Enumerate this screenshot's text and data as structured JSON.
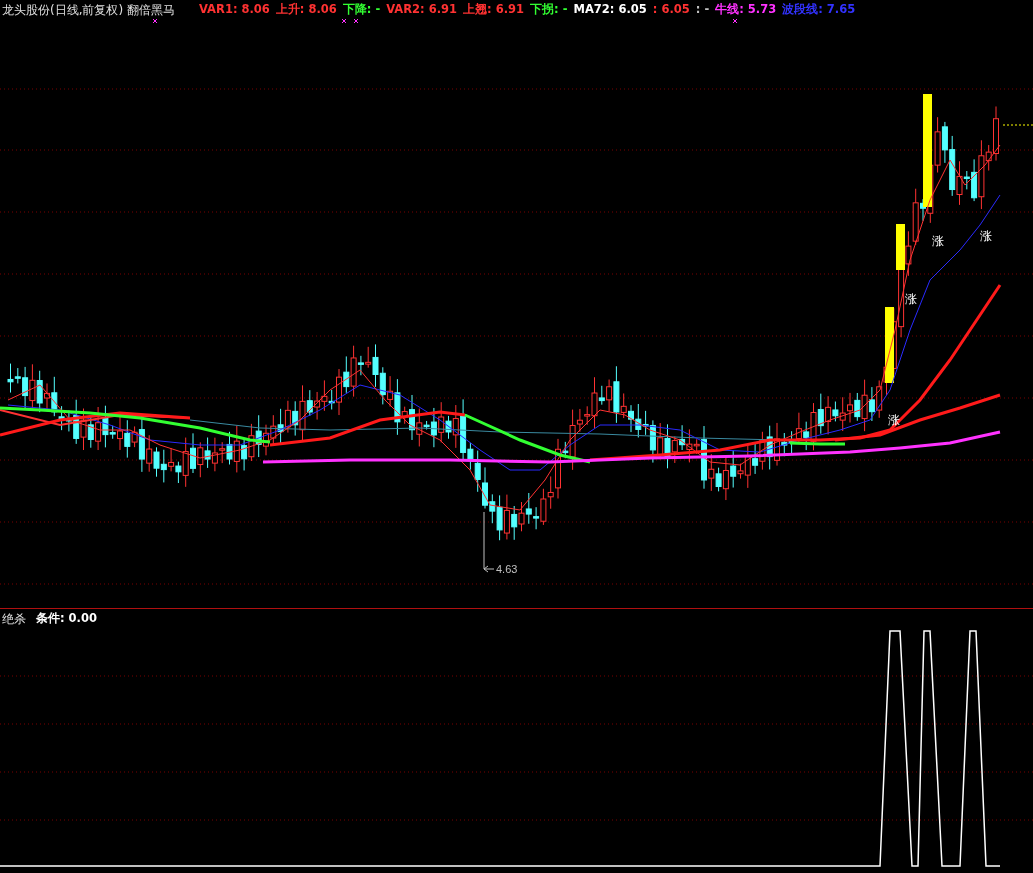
{
  "title": "龙头股份(日线,前复权) 翻倍黑马",
  "legend": [
    {
      "text": "VAR1: 8.06",
      "color": "#ff3232"
    },
    {
      "text": "上升: 8.06",
      "color": "#ff3232"
    },
    {
      "text": "下降: -",
      "color": "#32ff32"
    },
    {
      "text": "VAR2: 6.91",
      "color": "#ff3232"
    },
    {
      "text": "上翘: 6.91",
      "color": "#ff3232"
    },
    {
      "text": "下拐: -",
      "color": "#32ff32"
    },
    {
      "text": "MA72: 6.05",
      "color": "#ffffff"
    },
    {
      "text": ": 6.05",
      "color": "#ff3232"
    },
    {
      "text": ": -",
      "color": "#c0c0c0"
    },
    {
      "text": "牛线: 5.73",
      "color": "#ff32ff"
    },
    {
      "text": "波段线: 7.65",
      "color": "#3232ff"
    }
  ],
  "price_label": "4.63",
  "signal_labels": [
    "涨",
    "涨",
    "涨",
    "涨"
  ],
  "lower_panel": {
    "title": "绝杀",
    "legend": [
      {
        "text": "条件: 0.00",
        "color": "#ffffff"
      }
    ]
  }
}
